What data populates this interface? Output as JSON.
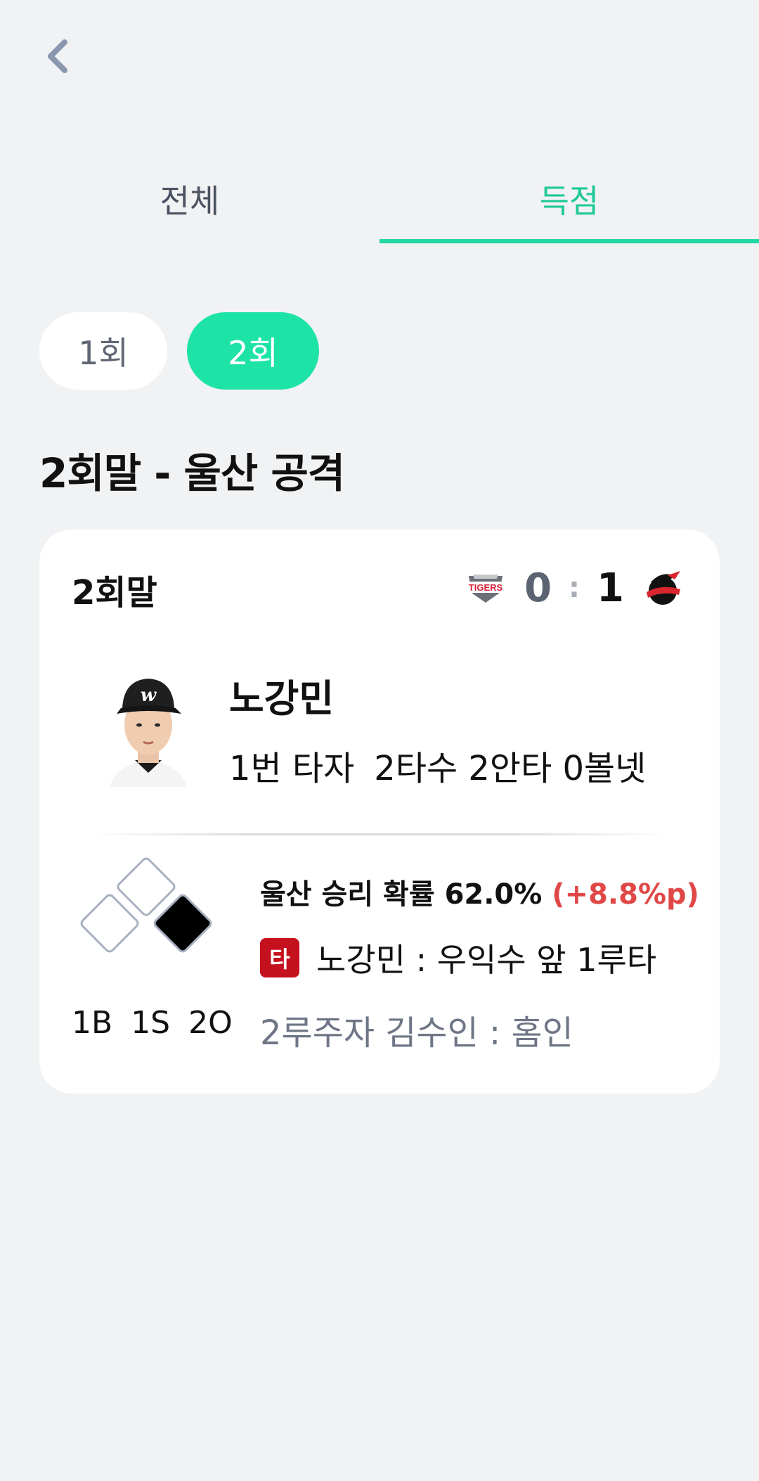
{
  "tabs": [
    {
      "label": "전체",
      "active": false
    },
    {
      "label": "득점",
      "active": true
    }
  ],
  "innings": [
    {
      "label": "1회",
      "active": false
    },
    {
      "label": "2회",
      "active": true
    }
  ],
  "section_title": "2회말 - 울산 공격",
  "card": {
    "inning_label": "2회말",
    "away_team": {
      "logo": "tigers-logo",
      "score": "0"
    },
    "separator": ":",
    "home_team": {
      "logo": "whales-logo",
      "score": "1"
    },
    "player": {
      "name": "노강민",
      "order": "1번 타자",
      "stats": "2타수 2안타 0볼넷",
      "avatar": "player-photo"
    },
    "count": {
      "balls": "1B",
      "strikes": "1S",
      "outs": "2O"
    },
    "win_probability": {
      "text": "울산 승리 확률 62.0%",
      "delta": "(+8.8%p)"
    },
    "play": {
      "badge": "타",
      "text": "노강민 : 우익수 앞 1루타"
    },
    "runner": "2루주자 김수인 : 홈인"
  },
  "colors": {
    "accent": "#1ee3a6",
    "accent_text": "#20c997",
    "delta": "#e04848",
    "badge": "#c5111d"
  }
}
